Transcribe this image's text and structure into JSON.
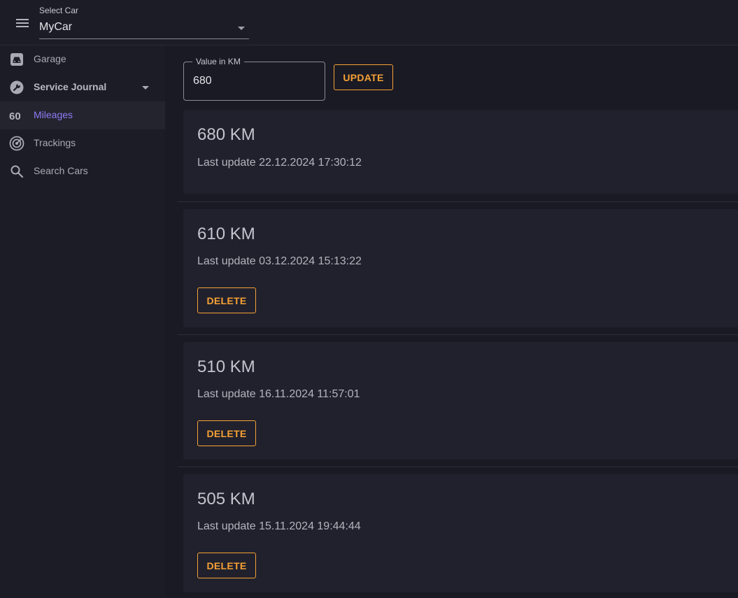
{
  "header": {
    "menu_icon": "menu-icon",
    "select_label": "Select Car",
    "selected_car": "MyCar"
  },
  "sidebar": {
    "items": [
      {
        "label": "Garage",
        "icon": "garage-icon"
      },
      {
        "label": "Service Journal",
        "icon": "wrench-icon",
        "expandable": true
      },
      {
        "label": "Mileages",
        "icon": "speed-60-icon",
        "active": true
      },
      {
        "label": "Trackings",
        "icon": "radar-icon"
      },
      {
        "label": "Search Cars",
        "icon": "search-icon"
      }
    ]
  },
  "main": {
    "input": {
      "label": "Value in KM",
      "value": "680"
    },
    "update_label": "UPDATE",
    "entries": [
      {
        "km": "680 KM",
        "updated": "Last update 22.12.2024 17:30:12"
      },
      {
        "km": "610 KM",
        "updated": "Last update 03.12.2024 15:13:22",
        "delete_label": "DELETE"
      },
      {
        "km": "510 KM",
        "updated": "Last update 16.11.2024 11:57:01",
        "delete_label": "DELETE"
      },
      {
        "km": "505 KM",
        "updated": "Last update 15.11.2024 19:44:44",
        "delete_label": "DELETE"
      }
    ]
  },
  "colors": {
    "accent": "#f7a134",
    "active_nav": "#8b7cf6",
    "background": "#1a1a24",
    "card": "#21212d"
  }
}
